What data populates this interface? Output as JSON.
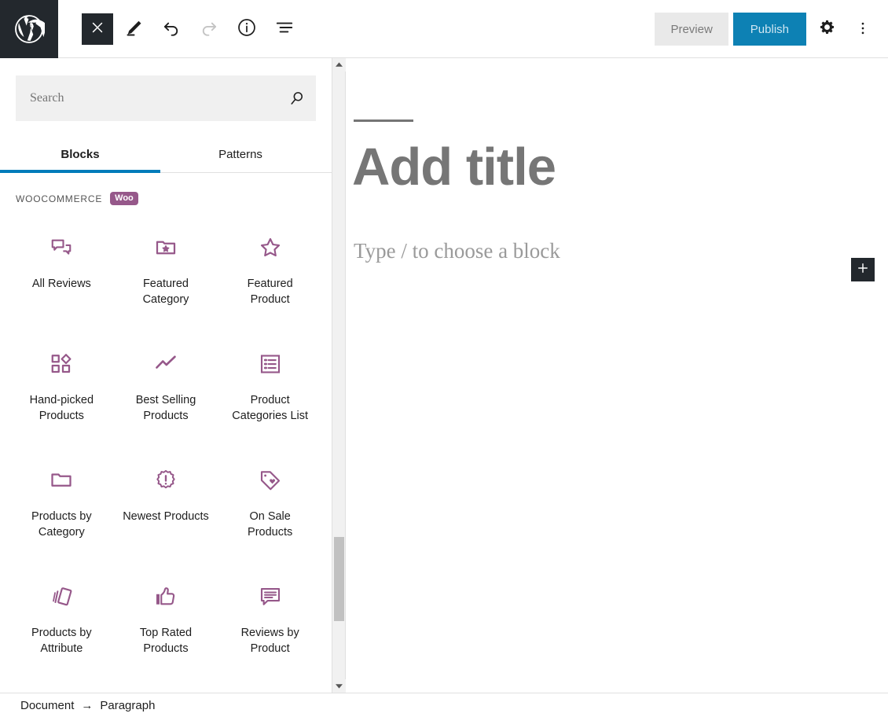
{
  "topbar": {
    "logo_icon": "wordpress-logo-icon",
    "left_buttons": [
      {
        "name": "close-button",
        "icon": "close-x-icon",
        "label": "Close",
        "enabled": true
      },
      {
        "name": "edit-button",
        "icon": "pencil-edit-icon",
        "label": "Edit",
        "enabled": true
      },
      {
        "name": "undo-button",
        "icon": "undo-arrow-icon",
        "label": "Undo",
        "enabled": true
      },
      {
        "name": "redo-button",
        "icon": "redo-arrow-icon",
        "label": "Redo",
        "enabled": false
      },
      {
        "name": "details-button",
        "icon": "info-circle-icon",
        "label": "Details",
        "enabled": true
      },
      {
        "name": "list-view-button",
        "icon": "list-view-icon",
        "label": "List view",
        "enabled": true
      }
    ],
    "preview_label": "Preview",
    "publish_label": "Publish",
    "settings_icon": "gear-icon",
    "more_icon": "more-vertical-dots-icon",
    "accent_blue": "#0d81b4",
    "preview_bg": "#e9e9e9"
  },
  "inserter": {
    "search": {
      "value": "",
      "placeholder": "Search",
      "icon": "search-magnifier-icon"
    },
    "tabs": [
      {
        "label": "Blocks",
        "active": true
      },
      {
        "label": "Patterns",
        "active": false
      }
    ],
    "active_tab_color": "#007cba",
    "category": {
      "title": "WOOCOMMERCE",
      "badge": "Woo",
      "badge_color": "#96588a"
    },
    "icon_color": "#96588a",
    "blocks": [
      {
        "label": "All Reviews",
        "icon": "speech-bubbles-icon"
      },
      {
        "label": "Featured Category",
        "icon": "folder-star-icon"
      },
      {
        "label": "Featured Product",
        "icon": "star-outline-icon"
      },
      {
        "label": "Hand-picked Products",
        "icon": "grid-diamond-icon"
      },
      {
        "label": "Best Selling Products",
        "icon": "trend-line-icon"
      },
      {
        "label": "Product Categories List",
        "icon": "list-box-icon"
      },
      {
        "label": "Products by Category",
        "icon": "folder-icon"
      },
      {
        "label": "Newest Products",
        "icon": "burst-exclamation-icon"
      },
      {
        "label": "On Sale Products",
        "icon": "tag-heart-icon"
      },
      {
        "label": "Products by Attribute",
        "icon": "cards-stack-icon"
      },
      {
        "label": "Top Rated Products",
        "icon": "thumbs-up-icon"
      },
      {
        "label": "Reviews by Product",
        "icon": "comment-lines-icon"
      }
    ],
    "scrollbar": {
      "up_icon": "scroll-up-arrow-icon",
      "down_icon": "scroll-down-arrow-icon"
    }
  },
  "canvas": {
    "title_placeholder": "Add title",
    "paragraph_placeholder": "Type / to choose a block",
    "add_block_icon": "plus-icon"
  },
  "footer": {
    "breadcrumb": [
      {
        "label": "Document"
      },
      {
        "label": "Paragraph"
      }
    ],
    "separator": "→"
  }
}
